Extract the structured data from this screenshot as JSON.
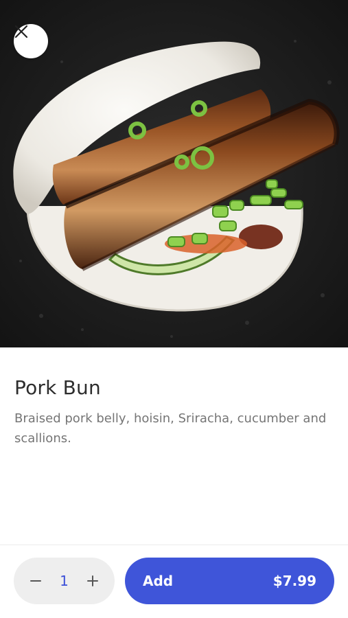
{
  "product": {
    "title": "Pork Bun",
    "description": "Braised pork belly, hoisin, Sriracha, cucumber and scallions.",
    "image_subject": "pork-bun-photo"
  },
  "header": {
    "close_icon": "close-icon"
  },
  "footer": {
    "quantity": "1",
    "decrement_icon": "minus-icon",
    "increment_icon": "plus-icon",
    "add_label": "Add",
    "price": "$7.99"
  },
  "colors": {
    "accent": "#3f55d9",
    "quantity_text": "#3b4fd8",
    "title_text": "#2d2d2d",
    "description_text": "#757575",
    "stepper_bg": "#eeeeee"
  }
}
